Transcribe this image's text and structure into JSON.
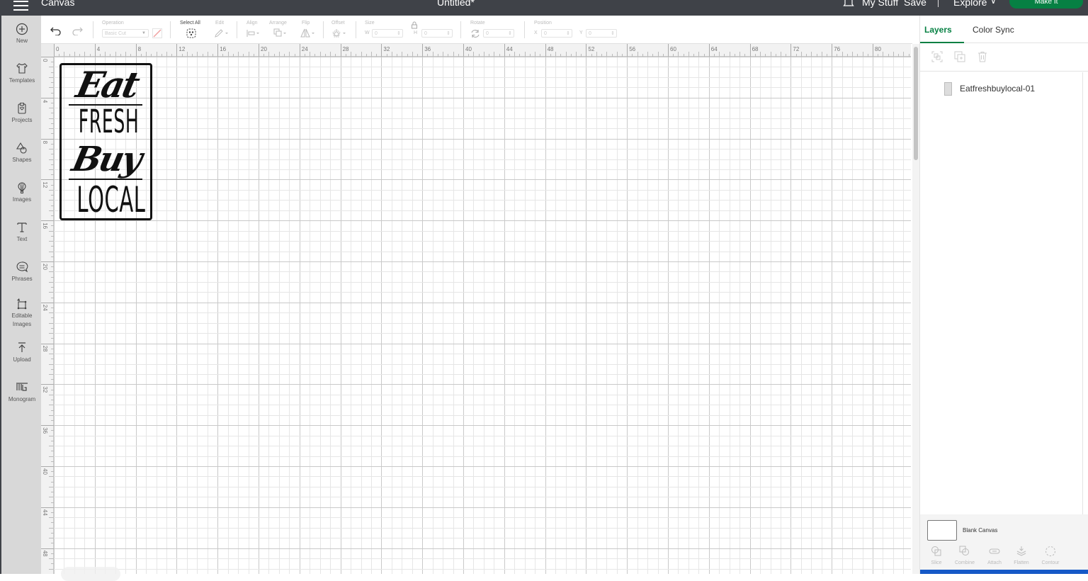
{
  "topbar": {
    "app_title": "Canvas",
    "doc_title": "Untitled*",
    "my_stuff": "My Stuff",
    "save": "Save",
    "explore": "Explore",
    "make_it": "Make It",
    "colors": {
      "bar": "#3f4248",
      "accent": "#068043"
    }
  },
  "sidebar": {
    "items": [
      {
        "label": "New",
        "icon": "plus-circle-icon"
      },
      {
        "label": "Templates",
        "icon": "tshirt-icon"
      },
      {
        "label": "Projects",
        "icon": "clipboard-heart-icon"
      },
      {
        "label": "Shapes",
        "icon": "shapes-icon"
      },
      {
        "label": "Images",
        "icon": "balloon-icon"
      },
      {
        "label": "Text",
        "icon": "text-t-icon"
      },
      {
        "label": "Phrases",
        "icon": "speech-bubble-icon"
      },
      {
        "label": "Editable",
        "label2": "Images",
        "icon": "editable-images-icon"
      },
      {
        "label": "Upload",
        "icon": "upload-icon"
      },
      {
        "label": "Monogram",
        "icon": "monogram-icon"
      }
    ]
  },
  "toolbar": {
    "operation_label": "Operation",
    "operation_value": "Basic Cut",
    "select_all": "Select All",
    "edit": "Edit",
    "align": "Align",
    "arrange": "Arrange",
    "flip": "Flip",
    "offset": "Offset",
    "size": "Size",
    "w_label": "W",
    "w_value": "0",
    "h_label": "H",
    "h_value": "0",
    "rotate": "Rotate",
    "rotate_value": "0",
    "position": "Position",
    "x_label": "X",
    "x_value": "0",
    "y_label": "Y",
    "y_value": "0"
  },
  "canvas": {
    "ruler_top": [
      "0",
      "4",
      "8",
      "12",
      "16",
      "20",
      "24",
      "28",
      "32",
      "36",
      "40",
      "44",
      "48",
      "52",
      "56",
      "60",
      "64",
      "68",
      "72",
      "76",
      "80"
    ],
    "ruler_left": [
      "0",
      "4",
      "8",
      "12",
      "16",
      "20",
      "24",
      "28",
      "32",
      "36",
      "40",
      "44",
      "48"
    ],
    "design": {
      "line1": "Eat",
      "line2": "FRESH",
      "line3": "Buy",
      "line4": "LOCAL"
    }
  },
  "panel": {
    "tabs": [
      {
        "label": "Layers",
        "active": true
      },
      {
        "label": "Color Sync",
        "active": false
      }
    ],
    "layers": [
      {
        "name": "Eatfreshbuylocal-01"
      }
    ],
    "blank_canvas": "Blank Canvas",
    "bottom_tools": [
      "Slice",
      "Combine",
      "Attach",
      "Flatten",
      "Contour"
    ]
  }
}
